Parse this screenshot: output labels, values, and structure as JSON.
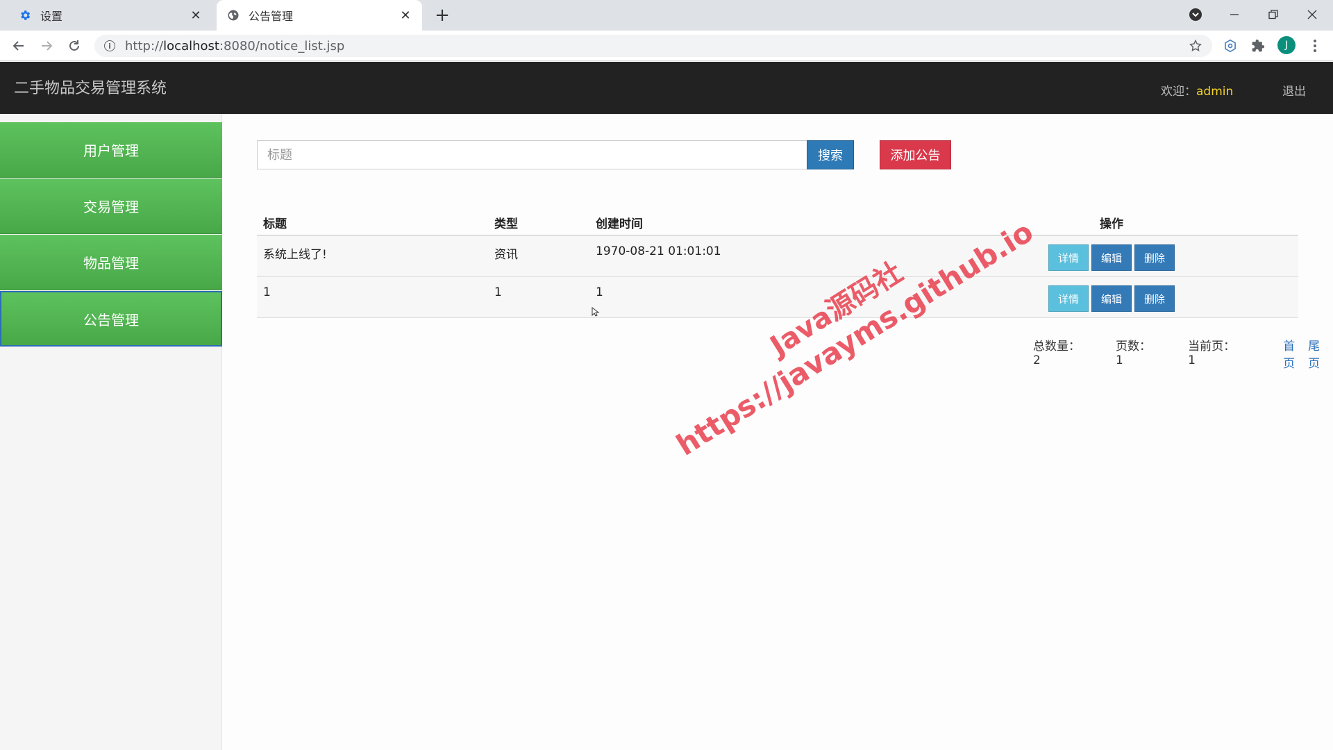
{
  "browser": {
    "tabs": [
      {
        "title": "设置",
        "icon": "gear-icon"
      },
      {
        "title": "公告管理",
        "icon": "globe-icon"
      }
    ],
    "url_prefix": "http://",
    "url_host": "localhost",
    "url_rest": ":8080/notice_list.jsp",
    "profile_initial": "J"
  },
  "header": {
    "title": "二手物品交易管理系统",
    "welcome_label": "欢迎：",
    "username": "admin",
    "logout": "退出"
  },
  "sidebar": {
    "items": [
      {
        "label": "用户管理"
      },
      {
        "label": "交易管理"
      },
      {
        "label": "物品管理"
      },
      {
        "label": "公告管理",
        "active": true
      }
    ]
  },
  "search": {
    "placeholder": "标题",
    "button": "搜索",
    "add_button": "添加公告"
  },
  "table": {
    "headers": [
      "标题",
      "类型",
      "创建时间",
      "操作"
    ],
    "rows": [
      {
        "title": "系统上线了!",
        "type": "资讯",
        "time": "1970-08-21 01:01:01"
      },
      {
        "title": "1",
        "type": "1",
        "time": "1"
      }
    ],
    "actions": {
      "detail": "详情",
      "edit": "编辑",
      "delete": "删除"
    }
  },
  "pager": {
    "total_label": "总数量：",
    "total": "2",
    "pages_label": "页数：",
    "pages": "1",
    "current_label": "当前页：",
    "current": "1",
    "first": "首页",
    "last": "尾页"
  },
  "watermark": {
    "line1": "Java源码社",
    "line2": "https://javayms.github.io"
  },
  "colors": {
    "header_bg": "#222222",
    "sidebar_green": "#4cae4c",
    "primary": "#337ab7",
    "danger": "#d9394b",
    "info": "#5bc0de",
    "username": "#f6d42b"
  }
}
